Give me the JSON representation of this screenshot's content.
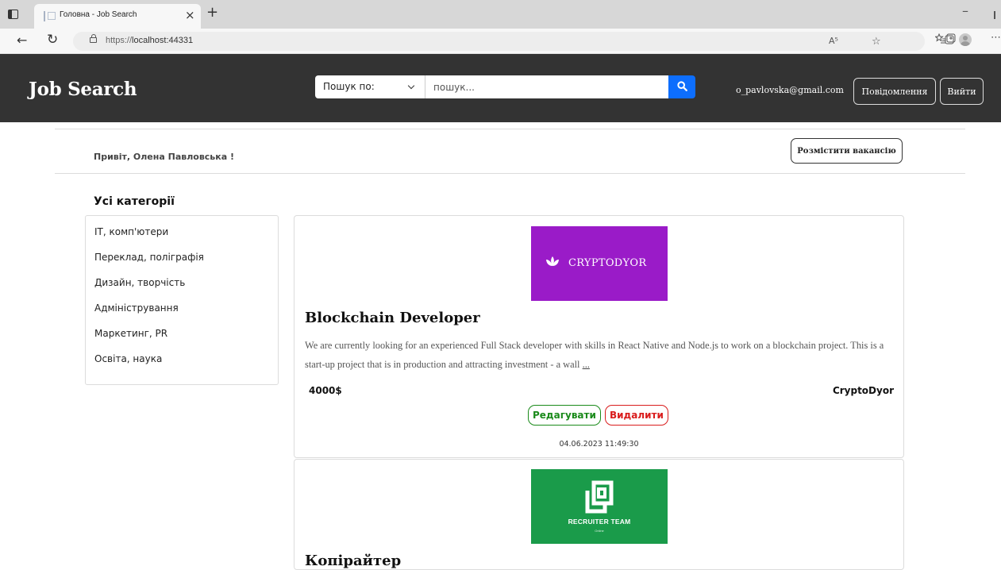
{
  "browser": {
    "tab_title": "Головна - Job Search",
    "url_scheme": "https://",
    "url_host": "localhost:44331",
    "read_aloud_label": "A⁵"
  },
  "header": {
    "logo": "Job Search",
    "search_select_label": "Пошук по:",
    "search_placeholder": "пошук...",
    "user_email": "o_pavlovska@gmail.com",
    "notifications_label": "Повідомлення",
    "logout_label": "Вийти"
  },
  "greeting": {
    "text": "Привіт, Олена Павловська !",
    "post_vacancy_label": "Розмістити вакансію"
  },
  "categories": {
    "title": "Усі категорії",
    "items": [
      "IT, комп'ютери",
      "Переклад, поліграфія",
      "Дизайн, творчість",
      "Адміністрування",
      "Маркетинг, PR",
      "Освіта, наука"
    ]
  },
  "jobs": [
    {
      "logo_text": "CRYPTODYOR",
      "title": "Blockchain Developer",
      "description": "We are currently looking for an experienced Full Stack developer with skills in React Native and Node.js to work on a blockchain project. This is a start-up project that is in production and attracting investment - a wall ",
      "more_link": "...",
      "salary": "4000$",
      "company": "CryptoDyor",
      "edit_label": "Редагувати",
      "delete_label": "Видалити",
      "date": "04.06.2023 11:49:30",
      "logo_color": "#9a1bc8"
    },
    {
      "logo_text": "RECRUITER TEAM",
      "logo_subtext": "Online",
      "title": "Копірайтер",
      "logo_color": "#1a9b4a"
    }
  ],
  "colors": {
    "header_bg": "#333333",
    "search_button": "#0d6efd",
    "edit": "#1a8a1a",
    "delete": "#d91c1c"
  }
}
